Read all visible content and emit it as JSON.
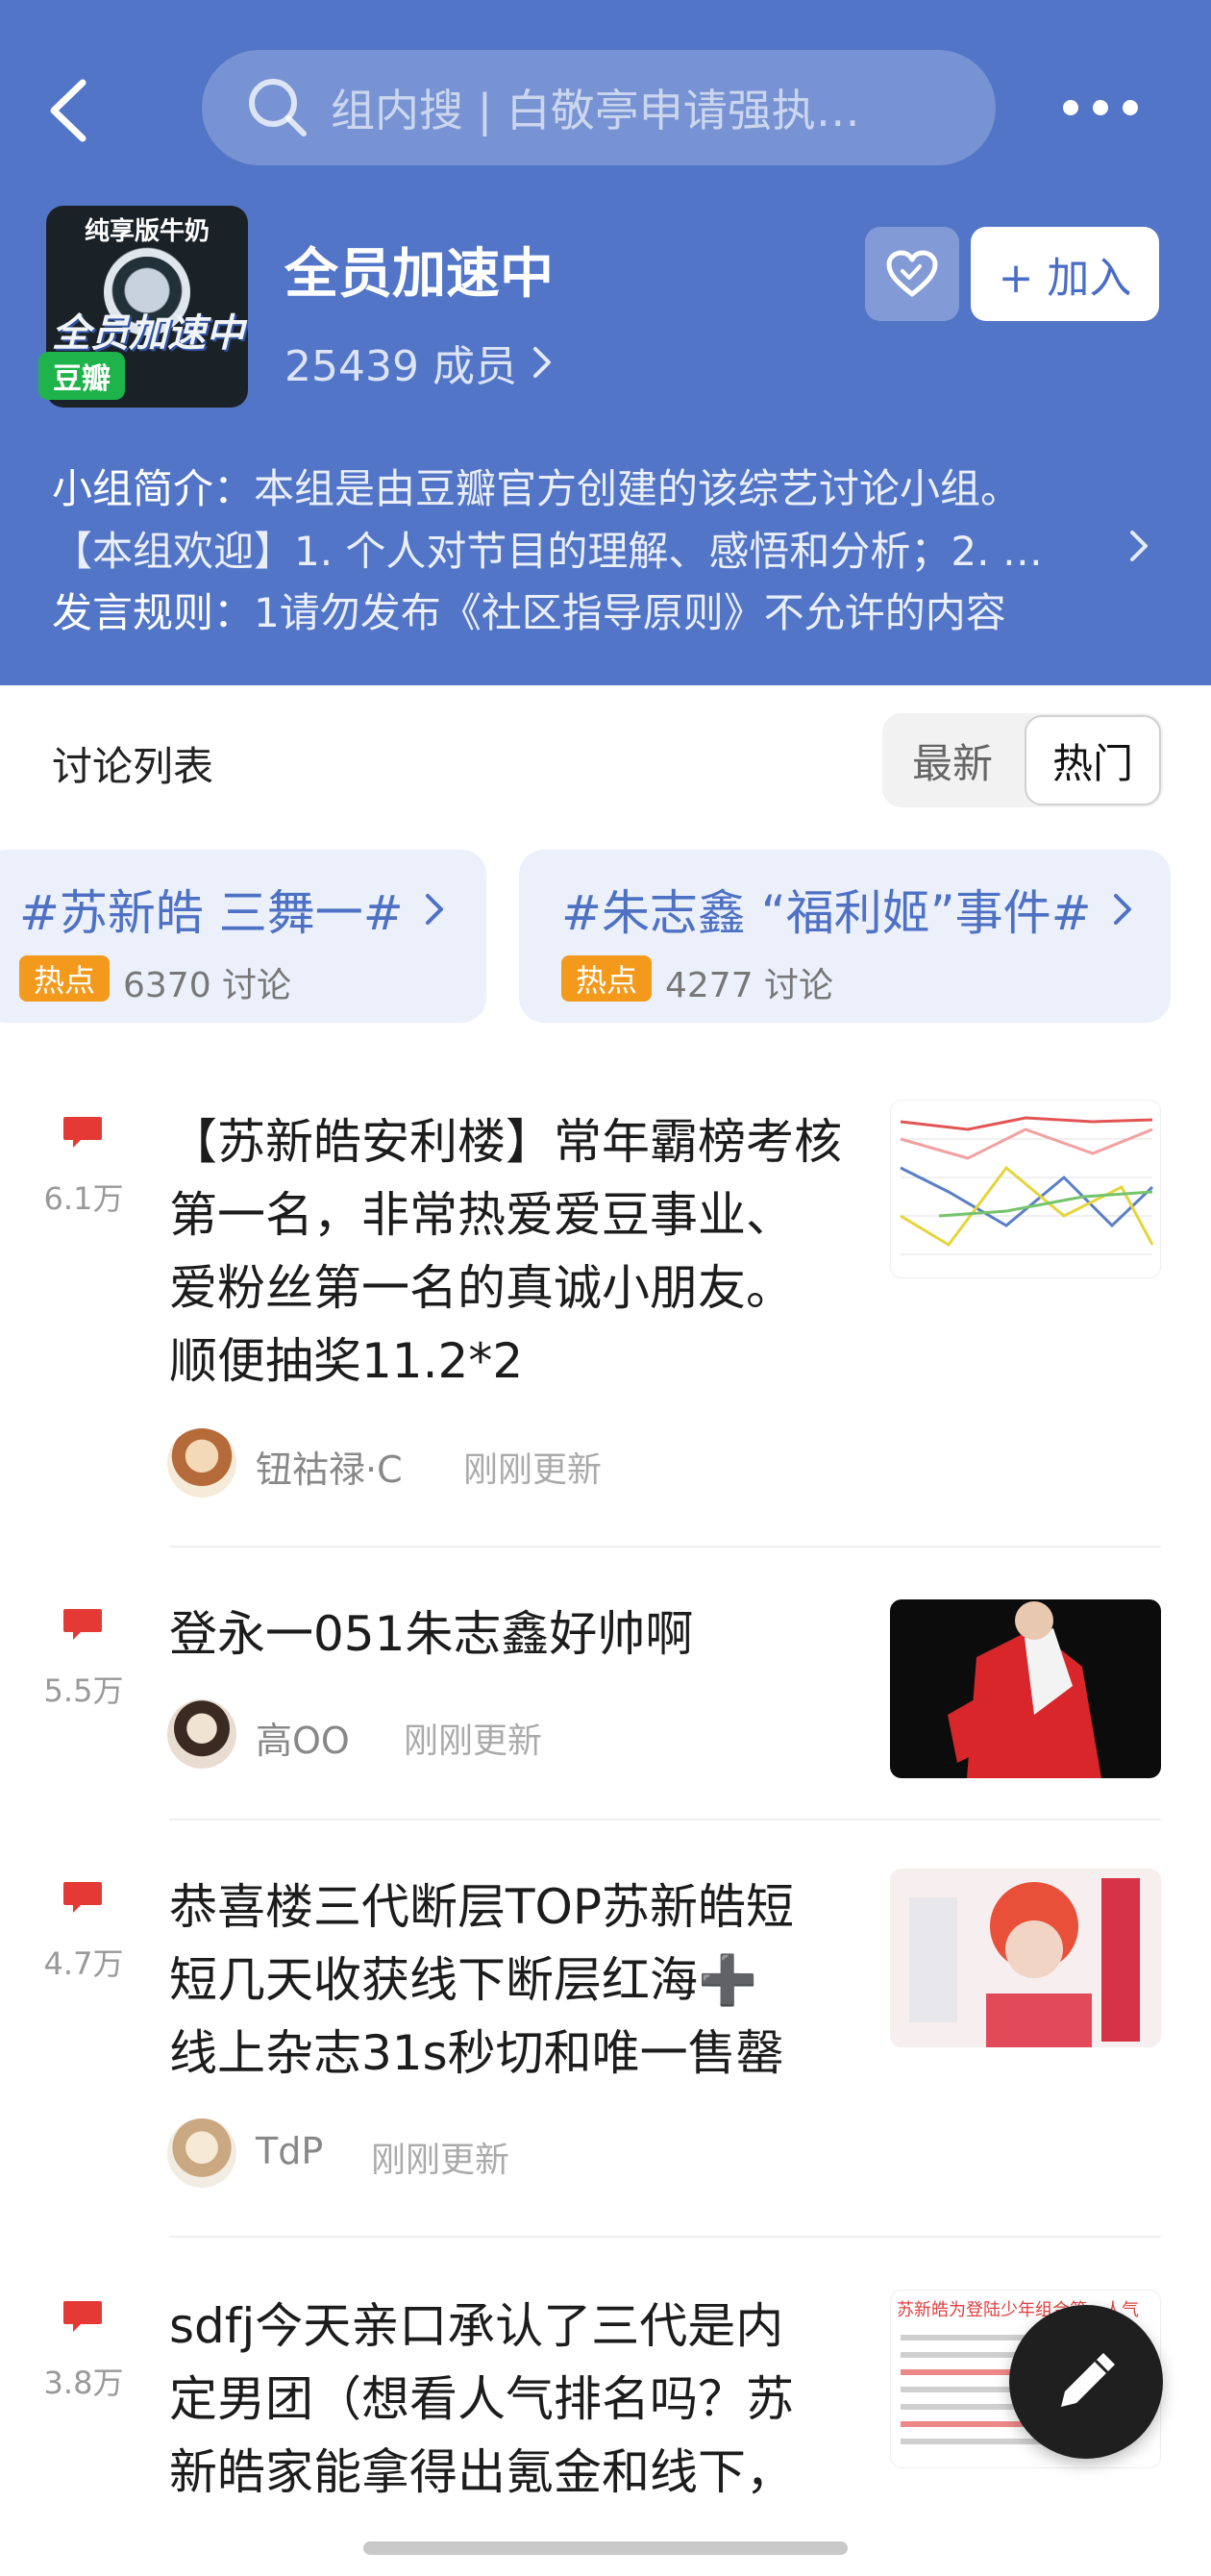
{
  "search": {
    "placeholder": "组内搜 | 白敬亭申请强执…"
  },
  "group": {
    "avatar_text": "纯享版牛奶",
    "avatar_title": "全员加速中",
    "badge": "豆瓣",
    "name": "全员加速中",
    "members": "25439 成员",
    "join_label": "+ 加入"
  },
  "intro": {
    "intro_label": "小组简介：",
    "intro_text": "本组是由豆瓣官方创建的该综艺讨论小组。",
    "welcome_text": "【本组欢迎】1. 个人对节目的理解、感悟和分析；2. …",
    "rules_label": "发言规则：",
    "rules_text": "1请勿发布《社区指导原则》不允许的内容"
  },
  "discussions": {
    "title": "讨论列表",
    "sort_latest": "最新",
    "sort_hot": "热门"
  },
  "topics": [
    {
      "title": "#苏新皓 三舞一#",
      "tag": "热点",
      "count": "6370 讨论"
    },
    {
      "title": "#朱志鑫 “福利姬”事件#",
      "tag": "热点",
      "count": "4277 讨论"
    }
  ],
  "posts": [
    {
      "replies": "6.1万",
      "title_lines": [
        "【苏新皓安利楼】常年霸榜考核",
        "第一名，非常热爱爱豆事业、",
        "爱粉丝第一名的真诚小朋友。",
        "顺便抽奖11.2*2"
      ],
      "author": "钮祜禄·C",
      "time": "刚刚更新"
    },
    {
      "replies": "5.5万",
      "title_lines": [
        "登永一051朱志鑫好帅啊"
      ],
      "author": "高OO",
      "time": "刚刚更新"
    },
    {
      "replies": "4.7万",
      "title_lines": [
        "恭喜楼三代断层TOP苏新皓短",
        "短几天收获线下断层红海➕",
        "线上杂志31s秒切和唯一售罄"
      ],
      "author": "TdP",
      "time": "刚刚更新"
    },
    {
      "replies": "3.8万",
      "title_lines": [
        "sdfj今天亲口承认了三代是内",
        "定男团（想看人气排名吗？苏",
        "新皓家能拿得出氪金和线下，"
      ],
      "thumb_text": "苏新皓为登陆少年组合第一人气"
    }
  ],
  "icons": {
    "back": "chevron-left-icon",
    "search": "search-icon",
    "more": "more-dots-icon",
    "fav": "heart-icon",
    "reply": "comment-bubble-icon",
    "fab": "pen-icon"
  },
  "colors": {
    "header_bg": "#5275c7",
    "topic_bg": "#ebf0fb",
    "topic_text": "#4e71c4",
    "hot_tag": "#f39a1d",
    "reply_icon": "#e53935",
    "douban_green": "#1fb34b"
  }
}
